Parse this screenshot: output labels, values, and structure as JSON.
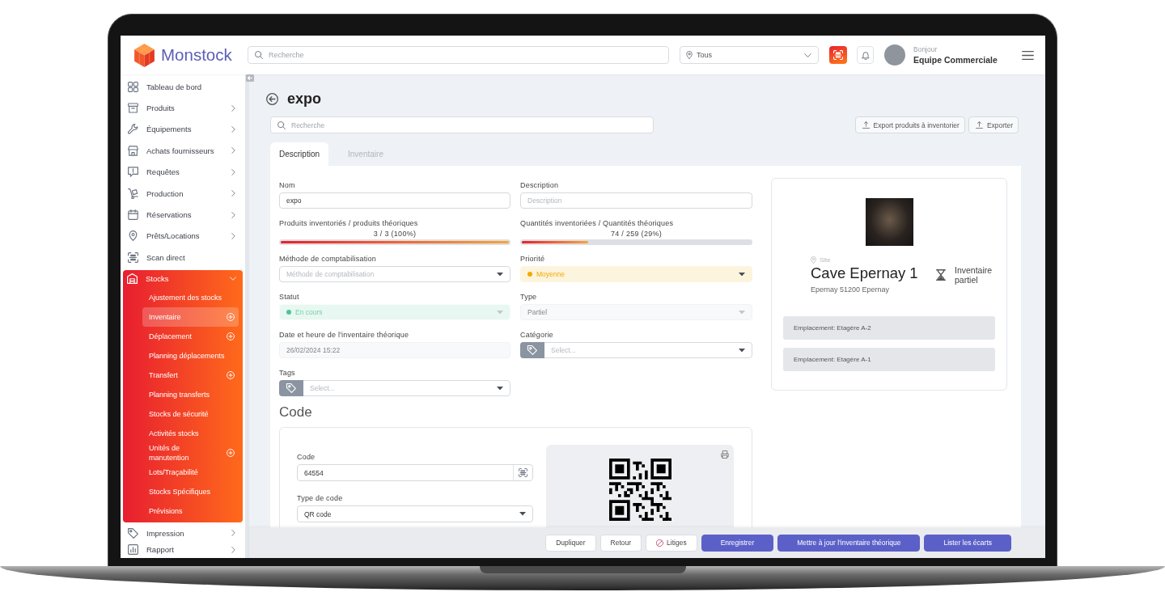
{
  "header": {
    "logo": "Monstock",
    "search": {
      "placeholder": "Recherche"
    },
    "location": {
      "value": "Tous"
    },
    "user": {
      "greeting": "Bonjour",
      "name": "Equipe Commerciale"
    }
  },
  "sidebar": {
    "items": [
      {
        "label": "Tableau de bord",
        "kind": "link",
        "selected": false
      },
      {
        "label": "Produits",
        "kind": "group",
        "expanded": false,
        "selected": false
      },
      {
        "label": "Équipements",
        "kind": "group",
        "expanded": false,
        "selected": false
      },
      {
        "label": "Achats fournisseurs",
        "kind": "group",
        "expanded": false,
        "selected": false
      },
      {
        "label": "Requêtes",
        "kind": "group",
        "expanded": false,
        "selected": false
      },
      {
        "label": "Production",
        "kind": "group",
        "expanded": false,
        "selected": false
      },
      {
        "label": "Réservations",
        "kind": "group",
        "expanded": false,
        "selected": false
      },
      {
        "label": "Prêts/Locations",
        "kind": "group",
        "expanded": false,
        "selected": false
      },
      {
        "label": "Scan direct",
        "kind": "link",
        "selected": false
      },
      {
        "label": "Stocks",
        "kind": "group",
        "expanded": true,
        "selected": true,
        "children": [
          {
            "label": "Ajustement des stocks",
            "addable": false,
            "selected": false
          },
          {
            "label": "Inventaire",
            "addable": true,
            "selected": true
          },
          {
            "label": "Déplacement",
            "addable": true,
            "selected": false
          },
          {
            "label": "Planning déplacements",
            "addable": false,
            "selected": false
          },
          {
            "label": "Transfert",
            "addable": true,
            "selected": false
          },
          {
            "label": "Planning transferts",
            "addable": false,
            "selected": false
          },
          {
            "label": "Stocks de sécurité",
            "addable": false,
            "selected": false
          },
          {
            "label": "Activités stocks",
            "addable": false,
            "selected": false
          },
          {
            "label": "Unités de manutention",
            "addable": true,
            "selected": false
          },
          {
            "label": "Lots/Traçabilité",
            "addable": false,
            "selected": false
          },
          {
            "label": "Stocks Spécifiques",
            "addable": false,
            "selected": false
          },
          {
            "label": "Prévisions",
            "addable": false,
            "selected": false
          }
        ]
      },
      {
        "label": "Impression",
        "kind": "group",
        "expanded": false,
        "selected": false
      },
      {
        "label": "Rapport",
        "kind": "group",
        "expanded": false,
        "selected": false
      }
    ]
  },
  "page": {
    "title": "expo",
    "search": {
      "placeholder": "Recherche"
    },
    "actions": [
      "Export produits à inventorier",
      "Exporter"
    ],
    "tabs": [
      {
        "label": "Description",
        "selected": true
      },
      {
        "label": "Inventaire",
        "selected": false
      }
    ]
  },
  "form": {
    "fields": [
      {
        "kind": "input",
        "label": "Nom",
        "value": "expo",
        "disabled": false
      },
      {
        "kind": "input",
        "label": "Description",
        "placeholder": "Description",
        "disabled": false
      },
      {
        "kind": "progress",
        "label": "Produits inventoriés / produits théoriques",
        "reading": "3 / 3 (100%)",
        "level": 1
      },
      {
        "kind": "progress",
        "label": "Quantités inventoriées / Quantités théoriques",
        "reading": "74 / 259 (29%)",
        "level": 0.29
      },
      {
        "kind": "select",
        "label": "Méthode de comptabilisation",
        "placeholder": "Méthode de comptabilisation",
        "disabled": false
      },
      {
        "kind": "select",
        "label": "Priorité",
        "value": "Moyenne",
        "color": "#f2a900",
        "disabled": false
      },
      {
        "kind": "select",
        "label": "Statut",
        "value": "En cours",
        "color": "#4fc497",
        "disabled": true
      },
      {
        "kind": "select",
        "label": "Type",
        "value": "Partiel",
        "disabled": true
      },
      {
        "kind": "input",
        "label": "Date et heure de l'inventaire théorique",
        "value": "26/02/2024 15:22",
        "disabled": true
      },
      {
        "kind": "tag-select",
        "label": "Catégorie",
        "placeholder": "Select...",
        "disabled": false
      },
      {
        "kind": "tag-select",
        "label": "Tags",
        "placeholder": "Select...",
        "disabled": false
      }
    ]
  },
  "code_section": {
    "title": "Code",
    "fields": [
      {
        "kind": "scan-input",
        "label": "Code",
        "value": "64554",
        "disabled": false
      },
      {
        "kind": "select",
        "label": "Type de code",
        "value": "QR code",
        "disabled": false
      }
    ]
  },
  "site_card": {
    "label": "Site",
    "name": "Cave Epernay 1",
    "address": "Epernay 51200 Epernay",
    "inventory_type": "Inventaire partiel",
    "locations": [
      "Emplacement: Etagère A-2",
      "Emplacement: Etagère A-1"
    ]
  },
  "footer": {
    "buttons": [
      {
        "label": "Dupliquer",
        "kind": "secondary"
      },
      {
        "label": "Retour",
        "kind": "secondary"
      },
      {
        "label": "Litiges",
        "kind": "secondary-icon"
      },
      {
        "label": "Enregistrer",
        "kind": "primary"
      },
      {
        "label": "Mettre à jour l'inventaire théorique",
        "kind": "primary"
      },
      {
        "label": "Lister les écarts",
        "kind": "primary"
      }
    ]
  }
}
